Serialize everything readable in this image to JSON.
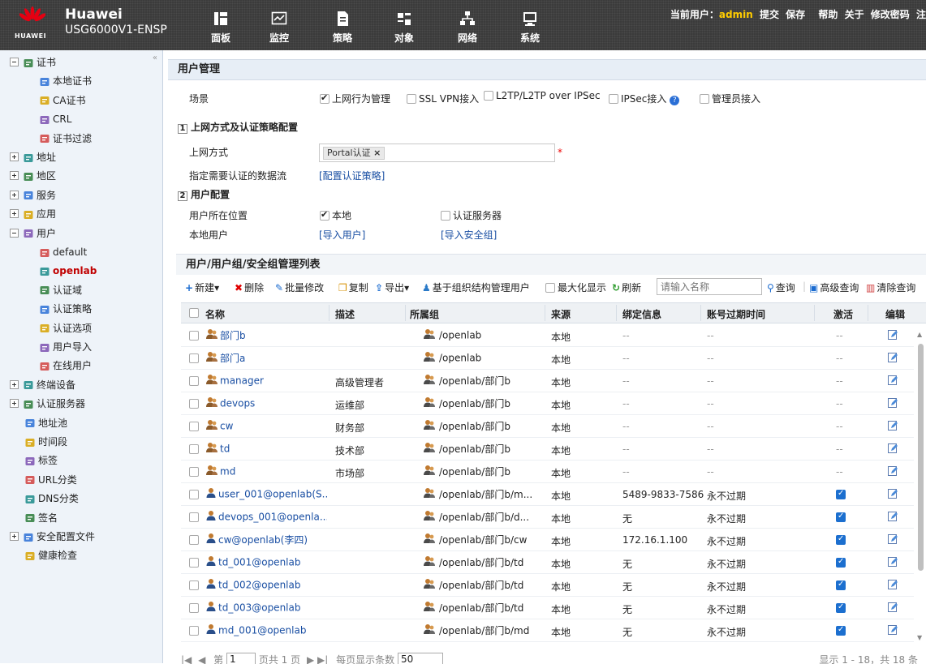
{
  "header": {
    "brand_name": "Huawei",
    "product": "USG6000V1-ENSP",
    "logo_word": "HUAWEI",
    "nav": [
      {
        "label": "面板",
        "icon": "dashboard-icon"
      },
      {
        "label": "监控",
        "icon": "monitor-icon"
      },
      {
        "label": "策略",
        "icon": "policy-icon"
      },
      {
        "label": "对象",
        "icon": "object-icon",
        "active": true
      },
      {
        "label": "网络",
        "icon": "network-icon"
      },
      {
        "label": "系统",
        "icon": "system-icon"
      }
    ],
    "current_user_label": "当前用户：",
    "current_user": "admin",
    "actions": [
      "提交",
      "保存",
      "帮助",
      "关于",
      "修改密码",
      "注"
    ]
  },
  "sidebar": {
    "items": [
      {
        "label": "证书",
        "level": 0,
        "toggle": "minus",
        "icon": "certificate-icon"
      },
      {
        "label": "本地证书",
        "level": 1,
        "icon": "local-certificate-icon"
      },
      {
        "label": "CA证书",
        "level": 1,
        "icon": "ca-certificate-icon"
      },
      {
        "label": "CRL",
        "level": 1,
        "icon": "crl-icon"
      },
      {
        "label": "证书过滤",
        "level": 1,
        "icon": "certificate-filter-icon"
      },
      {
        "label": "地址",
        "level": 0,
        "toggle": "plus",
        "icon": "address-icon"
      },
      {
        "label": "地区",
        "level": 0,
        "toggle": "plus",
        "icon": "region-icon"
      },
      {
        "label": "服务",
        "level": 0,
        "toggle": "plus",
        "icon": "service-icon"
      },
      {
        "label": "应用",
        "level": 0,
        "toggle": "plus",
        "icon": "application-icon"
      },
      {
        "label": "用户",
        "level": 0,
        "toggle": "minus",
        "icon": "user-icon"
      },
      {
        "label": "default",
        "level": 1,
        "icon": "user-group-icon"
      },
      {
        "label": "openlab",
        "level": 1,
        "icon": "user-group-icon",
        "selected": true
      },
      {
        "label": "认证域",
        "level": 1,
        "icon": "auth-domain-icon"
      },
      {
        "label": "认证策略",
        "level": 1,
        "icon": "auth-policy-icon"
      },
      {
        "label": "认证选项",
        "level": 1,
        "icon": "auth-option-icon"
      },
      {
        "label": "用户导入",
        "level": 1,
        "icon": "user-import-icon"
      },
      {
        "label": "在线用户",
        "level": 1,
        "icon": "online-user-icon"
      },
      {
        "label": "终端设备",
        "level": 0,
        "toggle": "plus",
        "icon": "terminal-icon"
      },
      {
        "label": "认证服务器",
        "level": 0,
        "toggle": "plus",
        "icon": "auth-server-icon"
      },
      {
        "label": "地址池",
        "level": 0,
        "icon": "address-pool-icon"
      },
      {
        "label": "时间段",
        "level": 0,
        "icon": "time-range-icon"
      },
      {
        "label": "标签",
        "level": 0,
        "icon": "tag-icon"
      },
      {
        "label": "URL分类",
        "level": 0,
        "icon": "url-category-icon"
      },
      {
        "label": "DNS分类",
        "level": 0,
        "icon": "dns-category-icon"
      },
      {
        "label": "签名",
        "level": 0,
        "icon": "signature-icon"
      },
      {
        "label": "安全配置文件",
        "level": 0,
        "toggle": "plus",
        "icon": "security-profile-icon"
      },
      {
        "label": "健康检查",
        "level": 0,
        "icon": "health-check-icon"
      }
    ]
  },
  "main": {
    "title": "用户管理",
    "scenario_label": "场景",
    "scenarios": [
      {
        "label": "上网行为管理",
        "checked": true
      },
      {
        "label": "SSL VPN接入",
        "checked": false
      },
      {
        "label": "L2TP/L2TP over IPSec",
        "checked": false
      },
      {
        "label": "IPSec接入",
        "checked": false
      },
      {
        "label": "管理员接入",
        "checked": false
      }
    ],
    "section1": {
      "num": "1",
      "title": "上网方式及认证策略配置"
    },
    "access_label": "上网方式",
    "access_tag": "Portal认证",
    "access_tag_remove": "×",
    "required_mark": "*",
    "flow_label": "指定需要认证的数据流",
    "flow_link": "[配置认证策略]",
    "section2": {
      "num": "2",
      "title": "用户配置"
    },
    "location_label": "用户所在位置",
    "location_local": "本地",
    "location_server": "认证服务器",
    "local_user_label": "本地用户",
    "import_user_link": "[导入用户]",
    "import_group_link": "[导入安全组]",
    "list_title": "用户/用户组/安全组管理列表",
    "toolbar": {
      "new": "新建",
      "delete": "删除",
      "batch_edit": "批量修改",
      "copy": "复制",
      "export": "导出",
      "org_manage": "基于组织结构管理用户",
      "maximize": "最大化显示",
      "refresh": "刷新",
      "search_placeholder": "请输入名称",
      "query": "查询",
      "advanced_query": "高级查询",
      "clear_query": "清除查询"
    },
    "columns": [
      "名称",
      "描述",
      "所属组",
      "来源",
      "绑定信息",
      "账号过期时间",
      "激活",
      "编辑"
    ],
    "rows": [
      {
        "name": "部门b",
        "desc": "",
        "group": "/openlab",
        "source": "本地",
        "bind": "--",
        "expire": "--",
        "active": "--",
        "type": "group"
      },
      {
        "name": "部门a",
        "desc": "",
        "group": "/openlab",
        "source": "本地",
        "bind": "--",
        "expire": "--",
        "active": "--",
        "type": "group"
      },
      {
        "name": "manager",
        "desc": "高级管理者",
        "group": "/openlab/部门b",
        "source": "本地",
        "bind": "--",
        "expire": "--",
        "active": "--",
        "type": "group"
      },
      {
        "name": "devops",
        "desc": "运维部",
        "group": "/openlab/部门b",
        "source": "本地",
        "bind": "--",
        "expire": "--",
        "active": "--",
        "type": "group"
      },
      {
        "name": "cw",
        "desc": "财务部",
        "group": "/openlab/部门b",
        "source": "本地",
        "bind": "--",
        "expire": "--",
        "active": "--",
        "type": "group"
      },
      {
        "name": "td",
        "desc": "技术部",
        "group": "/openlab/部门b",
        "source": "本地",
        "bind": "--",
        "expire": "--",
        "active": "--",
        "type": "group"
      },
      {
        "name": "md",
        "desc": "市场部",
        "group": "/openlab/部门b",
        "source": "本地",
        "bind": "--",
        "expire": "--",
        "active": "--",
        "type": "group"
      },
      {
        "name": "user_001@openlab(S...",
        "desc": "",
        "group": "/openlab/部门b/m...",
        "source": "本地",
        "bind": "5489-9833-7586",
        "expire": "永不过期",
        "active": "yes",
        "type": "user"
      },
      {
        "name": "devops_001@openla...",
        "desc": "",
        "group": "/openlab/部门b/d...",
        "source": "本地",
        "bind": "无",
        "expire": "永不过期",
        "active": "yes",
        "type": "user"
      },
      {
        "name": "cw@openlab(李四)",
        "desc": "",
        "group": "/openlab/部门b/cw",
        "source": "本地",
        "bind": "172.16.1.100",
        "expire": "永不过期",
        "active": "yes",
        "type": "user"
      },
      {
        "name": "td_001@openlab",
        "desc": "",
        "group": "/openlab/部门b/td",
        "source": "本地",
        "bind": "无",
        "expire": "永不过期",
        "active": "yes",
        "type": "user"
      },
      {
        "name": "td_002@openlab",
        "desc": "",
        "group": "/openlab/部门b/td",
        "source": "本地",
        "bind": "无",
        "expire": "永不过期",
        "active": "yes",
        "type": "user"
      },
      {
        "name": "td_003@openlab",
        "desc": "",
        "group": "/openlab/部门b/td",
        "source": "本地",
        "bind": "无",
        "expire": "永不过期",
        "active": "yes",
        "type": "user"
      },
      {
        "name": "md_001@openlab",
        "desc": "",
        "group": "/openlab/部门b/md",
        "source": "本地",
        "bind": "无",
        "expire": "永不过期",
        "active": "yes",
        "type": "user"
      }
    ],
    "pager": {
      "page_prefix": "第",
      "page": "1",
      "page_suffix": "页共 1 页",
      "per_page_label": "每页显示条数",
      "per_page": "50",
      "summary": "显示 1 - 18，共 18 条"
    }
  },
  "colors": {
    "header_bg": "#3b3b3b",
    "accent_red": "#c00000",
    "link": "#1a4fa3",
    "check_blue": "#1c6fcf"
  }
}
